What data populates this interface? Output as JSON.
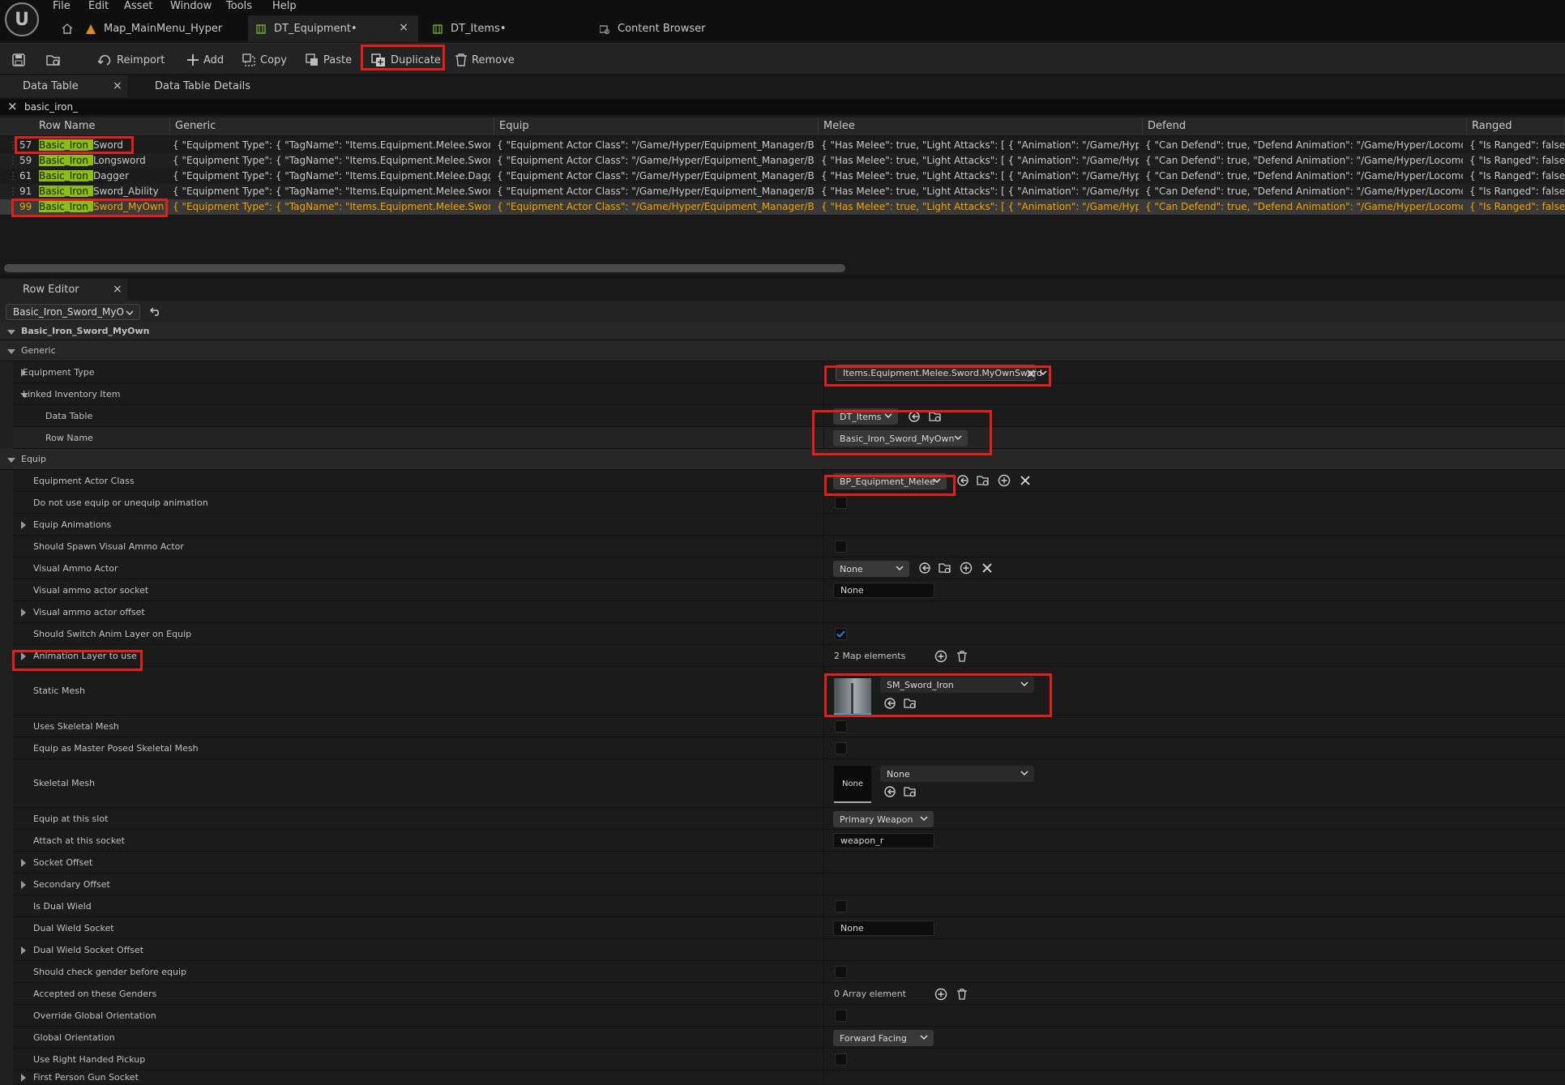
{
  "menu": [
    "File",
    "Edit",
    "Asset",
    "Window",
    "Tools",
    "Help"
  ],
  "tabs": [
    {
      "label": "Map_MainMenu_Hyper"
    },
    {
      "label": "DT_Equipment•"
    },
    {
      "label": "DT_Items•"
    },
    {
      "label": "Content Browser"
    }
  ],
  "toolbar": {
    "reimport": "Reimport",
    "add": "Add",
    "copy": "Copy",
    "paste": "Paste",
    "duplicate": "Duplicate",
    "remove": "Remove"
  },
  "panel_tabs": {
    "data_table": "Data Table",
    "details": "Data Table Details",
    "row_editor": "Row Editor"
  },
  "search": {
    "value": "basic_iron_"
  },
  "columns": [
    "Row Name",
    "Generic",
    "Equip",
    "Melee",
    "Defend",
    "Ranged"
  ],
  "rows": [
    {
      "num": "57",
      "pre": "Basic_Iron_",
      "name": "Sword",
      "generic": "{ \"Equipment Type\": { \"TagName\": \"Items.Equipment.Melee.Sword.",
      "ghl": "Basic_Ir",
      "equip": "{ \"Equipment Actor Class\": \"/Game/Hyper/Equipment_Manager/Blueprints",
      "melee": "{ \"Has Melee\": true, \"Light Attacks\": [ { \"Animation\": \"/Game/Hyper/Locomo",
      "defend": "{ \"Can Defend\": true, \"Defend Animation\": \"/Game/Hyper/Locomotion/Cha",
      "ranged": "{ \"Is Ranged\": false, \"F"
    },
    {
      "num": "59",
      "pre": "Basic_Iron_",
      "name": "Longsword",
      "generic": "{ \"Equipment Type\": { \"TagName\": \"Items.Equipment.Melee.Sword.",
      "ghl": "Basic_Ir",
      "equip": "{ \"Equipment Actor Class\": \"/Game/Hyper/Equipment_Manager/Blueprints",
      "melee": "{ \"Has Melee\": true, \"Light Attacks\": [ { \"Animation\": \"/Game/Hyper/Locomo",
      "defend": "{ \"Can Defend\": true, \"Defend Animation\": \"/Game/Hyper/Locomotion/Cha",
      "ranged": "{ \"Is Ranged\": false, \"F"
    },
    {
      "num": "61",
      "pre": "Basic_Iron_",
      "name": "Dagger",
      "generic": "{ \"Equipment Type\": { \"TagName\": \"Items.Equipment.Melee.Dagger.",
      "ghl": "Basic_",
      "equip": "{ \"Equipment Actor Class\": \"/Game/Hyper/Equipment_Manager/Blueprints",
      "melee": "{ \"Has Melee\": true, \"Light Attacks\": [ { \"Animation\": \"/Game/Hyper/Locomo",
      "defend": "{ \"Can Defend\": true, \"Defend Animation\": \"/Game/Hyper/Locomotion/Cha",
      "ranged": "{ \"Is Ranged\": false, \"F"
    },
    {
      "num": "91",
      "pre": "Basic_Iron_",
      "name": "Sword_Ability",
      "generic": "{ \"Equipment Type\": { \"TagName\": \"Items.Equipment.Melee.Sword.",
      "ghl": "Basic_Ir",
      "equip": "{ \"Equipment Actor Class\": \"/Game/Hyper/Equipment_Manager/Blueprints",
      "melee": "{ \"Has Melee\": true, \"Light Attacks\": [ { \"Animation\": \"/Game/Hyper/Locomo",
      "defend": "{ \"Can Defend\": true, \"Defend Animation\": \"/Game/Hyper/Locomotion/Cha",
      "ranged": "{ \"Is Ranged\": false, \"F"
    },
    {
      "num": "99",
      "pre": "Basic_Iron_",
      "name": "Sword_MyOwn",
      "generic": "{ \"Equipment Type\": { \"TagName\": \"Items.Equipment.Melee.Sword.MyOwnS",
      "ghl": "",
      "equip": "{ \"Equipment Actor Class\": \"/Game/Hyper/Equipment_Manager/Blueprints",
      "melee": "{ \"Has Melee\": true, \"Light Attacks\": [ { \"Animation\": \"/Game/Hyper/Locomo",
      "defend": "{ \"Can Defend\": true, \"Defend Animation\": \"/Game/Hyper/Locomotion/Cha",
      "ranged": "{ \"Is Ranged\": false, \"F"
    }
  ],
  "row_editor": {
    "selected_row": "Basic_Iron_Sword_MyO",
    "root": "Basic_Iron_Sword_MyOwn",
    "generic": "Generic",
    "equipment_type": "Equipment Type",
    "equipment_type_value": "Items.Equipment.Melee.Sword.MyOwnSword",
    "linked_inventory_item": "Linked Inventory Item",
    "data_table": "Data Table",
    "data_table_value": "DT_Items",
    "row_name": "Row Name",
    "row_name_value": "Basic_Iron_Sword_MyOwn",
    "equip": "Equip",
    "equipment_actor_class": "Equipment Actor Class",
    "equipment_actor_class_value": "BP_Equipment_Melee",
    "no_equip_anim": "Do not use equip or unequip animation",
    "equip_animations": "Equip Animations",
    "spawn_visual_ammo": "Should Spawn Visual Ammo Actor",
    "visual_ammo_actor": "Visual Ammo Actor",
    "visual_ammo_actor_value": "None",
    "visual_ammo_socket": "Visual ammo actor socket",
    "visual_ammo_socket_value": "None",
    "visual_ammo_offset": "Visual ammo actor offset",
    "switch_anim_layer": "Should Switch Anim Layer on Equip",
    "anim_layer": "Animation Layer to use",
    "anim_layer_value": "2 Map elements",
    "static_mesh": "Static Mesh",
    "static_mesh_value": "SM_Sword_Iron",
    "uses_skeletal": "Uses Skeletal Mesh",
    "master_posed": "Equip as Master Posed Skeletal Mesh",
    "skeletal_mesh": "Skeletal Mesh",
    "skeletal_mesh_thumb": "None",
    "skeletal_mesh_value": "None",
    "equip_slot": "Equip at this slot",
    "equip_slot_value": "Primary Weapon",
    "attach_socket": "Attach at this socket",
    "attach_socket_value": "weapon_r",
    "socket_offset": "Socket Offset",
    "secondary_offset": "Secondary Offset",
    "dual_wield": "Is Dual Wield",
    "dual_wield_socket": "Dual Wield Socket",
    "dual_wield_socket_value": "None",
    "dual_wield_socket_offset": "Dual Wield Socket Offset",
    "check_gender": "Should check gender before equip",
    "genders": "Accepted on these Genders",
    "genders_value": "0 Array element",
    "override_orientation": "Override Global Orientation",
    "global_orientation": "Global Orientation",
    "global_orientation_value": "Forward Facing",
    "right_hand_pickup": "Use Right Handed Pickup",
    "fp_gun_socket": "First Person Gun Socket"
  },
  "colors": {
    "highlight": "#8bbd14",
    "selected_text": "#f3a300",
    "annotation": "#e0201a",
    "accent": "#2d7ad6"
  }
}
